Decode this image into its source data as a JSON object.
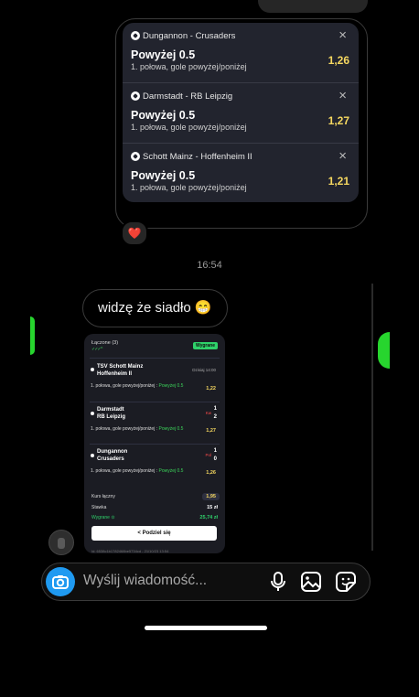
{
  "bet_slip": {
    "bets": [
      {
        "match": "Dungannon - Crusaders",
        "pick": "Powyżej 0.5",
        "market": "1. połowa, gole powyżej/poniżej",
        "odds": "1,26",
        "close": "×"
      },
      {
        "match": "Darmstadt - RB Leipzig",
        "pick": "Powyżej 0.5",
        "market": "1. połowa, gole powyżej/poniżej",
        "odds": "1,27",
        "close": "×"
      },
      {
        "match": "Schott Mainz - Hoffenheim II",
        "pick": "Powyżej 0.5",
        "market": "1. połowa, gole powyżej/poniżej",
        "odds": "1,21",
        "close": "×"
      }
    ]
  },
  "reaction": "❤️",
  "timestamp": "16:54",
  "message": {
    "text": "widzę że siadło 😁"
  },
  "shared_screenshot": {
    "header": "Łączone (3)",
    "dots": "✓✓✓ ^",
    "status_badge": "Wygrane",
    "rows": [
      {
        "team1": "TSV Schott Mainz",
        "team2": "Hoffenheim II",
        "meta": "Dzisiaj 14:00",
        "market": "1. połowa, gole powyżej/poniżej : ",
        "pick": "Powyżej 0.5",
        "odds": "1,22"
      },
      {
        "team1": "Darmstadt",
        "team2": "RB Leipzig",
        "live": "Kw",
        "score1": "1",
        "score2": "2",
        "market": "1. połowa, gole powyżej/poniżej : ",
        "pick": "Powyżej 0.5",
        "odds": "1,27"
      },
      {
        "team1": "Dungannon",
        "team2": "Crusaders",
        "live": "Pol",
        "score1": "1",
        "score2": "0",
        "market": "1. połowa, gole powyżej/poniżej : ",
        "pick": "Powyżej 0.5",
        "odds": "1,26"
      }
    ],
    "total_odds_label": "Kurs łączny",
    "total_odds": "1,95",
    "stake_label": "Stawka",
    "stake": "15 zł",
    "win_label": "Wygrane ⊙",
    "win": "25,74 zł",
    "share_label": "< Podziel się",
    "footer": "Id: 6538c1b1782468be5734cd - 21/10/23 13:54"
  },
  "composer": {
    "placeholder": "Wyślij wiadomość..."
  },
  "icons": [
    "camera-icon",
    "microphone-icon",
    "gallery-icon",
    "sticker-icon",
    "soccer-ball-icon",
    "close-icon"
  ],
  "colors": {
    "accent": "#1f9af1",
    "odds": "#f6d860",
    "win": "#2fd16a",
    "card": "#22242e"
  }
}
